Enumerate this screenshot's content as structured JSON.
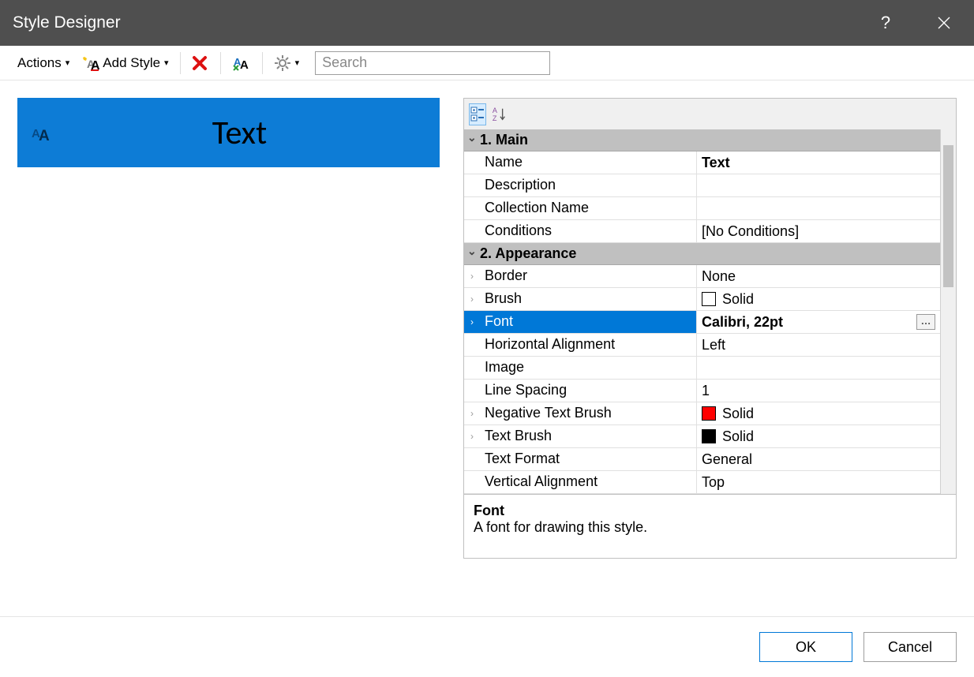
{
  "titlebar": {
    "title": "Style Designer",
    "help": "?",
    "close": "×"
  },
  "toolbar": {
    "actions": "Actions",
    "add_style": "Add Style",
    "search_placeholder": "Search"
  },
  "preview": {
    "text": "Text"
  },
  "property_grid": {
    "groups": [
      {
        "title": "1. Main",
        "rows": [
          {
            "label": "Name",
            "value": "Text",
            "bold_value": true
          },
          {
            "label": "Description",
            "value": ""
          },
          {
            "label": "Collection Name",
            "value": ""
          },
          {
            "label": "Conditions",
            "value": "[No Conditions]"
          }
        ]
      },
      {
        "title": "2. Appearance",
        "rows": [
          {
            "label": "Border",
            "value": "None",
            "expandable": true
          },
          {
            "label": "Brush",
            "value": "Solid",
            "swatch": "#ffffff",
            "expandable": true
          },
          {
            "label": "Font",
            "value": "Calibri, 22pt",
            "selected": true,
            "ellipsis": true,
            "expandable": true
          },
          {
            "label": "Horizontal Alignment",
            "value": "Left"
          },
          {
            "label": "Image",
            "value": ""
          },
          {
            "label": "Line Spacing",
            "value": "1"
          },
          {
            "label": "Negative Text Brush",
            "value": "Solid",
            "swatch": "#ff0000",
            "expandable": true
          },
          {
            "label": "Text Brush",
            "value": "Solid",
            "swatch": "#000000",
            "expandable": true
          },
          {
            "label": "Text Format",
            "value": "General"
          },
          {
            "label": "Vertical Alignment",
            "value": "Top"
          }
        ]
      }
    ],
    "description": {
      "title": "Font",
      "text": "A font for drawing this style."
    }
  },
  "footer": {
    "ok": "OK",
    "cancel": "Cancel"
  }
}
